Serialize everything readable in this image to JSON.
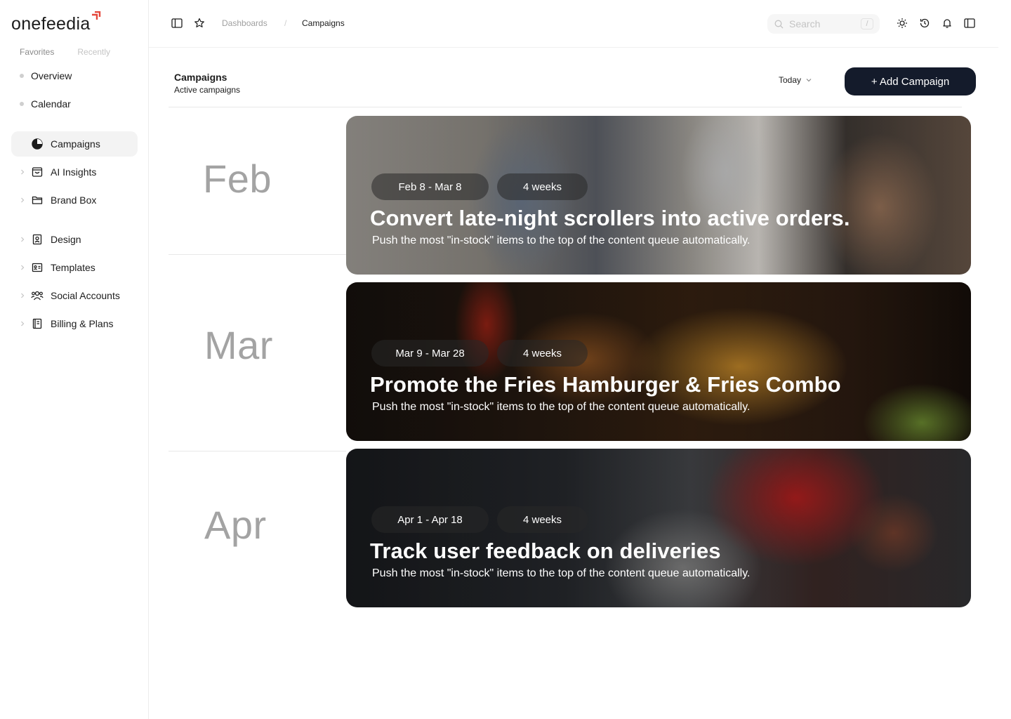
{
  "brand": {
    "name": "onefeedia",
    "accent": "#e5473b"
  },
  "sidebar": {
    "tabs": {
      "favorites": "Favorites",
      "recently": "Recently"
    },
    "quick": [
      {
        "label": "Overview"
      },
      {
        "label": "Calendar"
      }
    ],
    "items": [
      {
        "label": "Campaigns",
        "icon": "pie-chart-icon",
        "active": true
      },
      {
        "label": "AI Insights",
        "icon": "inbox-icon"
      },
      {
        "label": "Brand Box",
        "icon": "folder-icon"
      },
      {
        "label": "Design",
        "icon": "id-badge-icon"
      },
      {
        "label": "Templates",
        "icon": "id-card-icon"
      },
      {
        "label": "Social Accounts",
        "icon": "users-icon"
      },
      {
        "label": "Billing & Plans",
        "icon": "notebook-icon"
      }
    ]
  },
  "topbar": {
    "breadcrumb": {
      "parent": "Dashboards",
      "separator": "/",
      "current": "Campaigns"
    },
    "search": {
      "placeholder": "Search",
      "shortcut": "/"
    }
  },
  "page": {
    "title": "Campaigns",
    "subtitle": "Active campaigns",
    "filter": "Today",
    "add_button": "+ Add Campaign"
  },
  "campaigns": [
    {
      "month": "Feb",
      "dates": "Feb 8 - Mar 8",
      "duration": "4 weeks",
      "title": "Convert late-night scrollers into active orders.",
      "description": "Push the most \"in-stock\" items to the top of the content queue automatically."
    },
    {
      "month": "Mar",
      "dates": "Mar 9  - Mar 28",
      "duration": "4 weeks",
      "title": "Promote the Fries Hamburger & Fries Combo",
      "description": "Push the most \"in-stock\" items to the top of the content queue automatically."
    },
    {
      "month": "Apr",
      "dates": "Apr 1 - Apr 18",
      "duration": "4 weeks",
      "title": "Track user feedback on deliveries",
      "description": "Push the most \"in-stock\" items to the top of the content queue automatically."
    }
  ]
}
